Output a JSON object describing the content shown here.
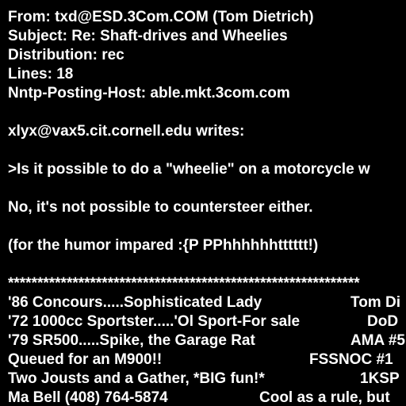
{
  "headers": {
    "from": "From: txd@ESD.3Com.COM (Tom Dietrich)",
    "subject": "Subject: Re: Shaft-drives and Wheelies",
    "distribution": "Distribution: rec",
    "lines": "Lines: 18",
    "nntp_host": "Nntp-Posting-Host: able.mkt.3com.com"
  },
  "body": {
    "attribution": "xlyx@vax5.cit.cornell.edu writes:",
    "quote": ">Is it possible to do a \"wheelie\" on a motorcycle w",
    "reply": "No, it's not possible to countersteer either.",
    "humor": "(for the humor impared :{P PPhhhhhhtttttt!)"
  },
  "signature": {
    "rule": "************************************************************",
    "rows": [
      {
        "left": "'86 Concours.....Sophisticated Lady",
        "right": "Tom Di"
      },
      {
        "left": "'72 1000cc Sportster.....'Ol Sport-For sale",
        "right": "DoD"
      },
      {
        "left": "'79 SR500.....Spike, the Garage Rat",
        "right": "AMA #5"
      },
      {
        "left": "Queued for an M900!!",
        "right": "FSSNOC #1"
      },
      {
        "left": "Two Jousts and a Gather, *BIG fun!*",
        "right": "1KSP"
      },
      {
        "left": "Ma Bell (408) 764-5874",
        "right": "Cool as a rule, but"
      }
    ]
  }
}
